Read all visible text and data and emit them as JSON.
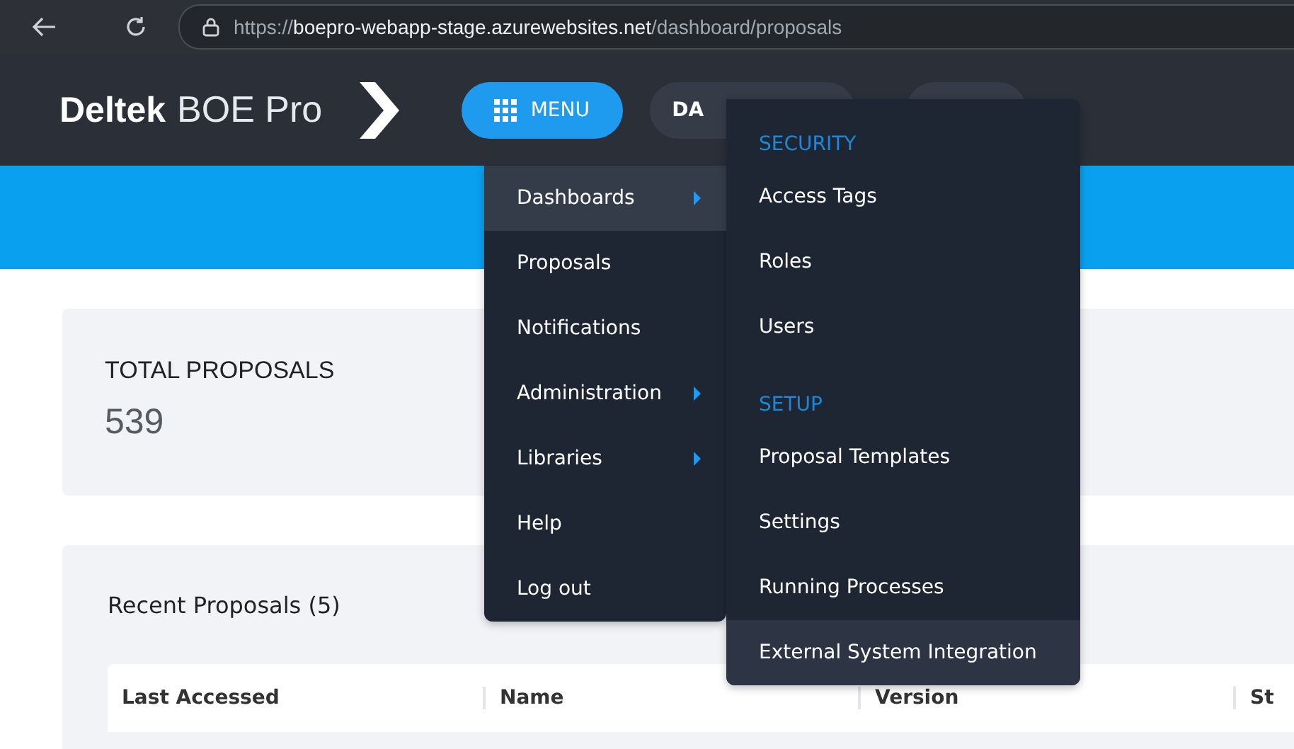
{
  "browser": {
    "url": "https://**boepro-webapp-stage.azurewebsites.net**/dashboard/proposals"
  },
  "header": {
    "brand_bold": "Deltek",
    "brand": "BOE Pro",
    "menu_button": "MENU",
    "nav_pills": [
      "DA"
    ]
  },
  "main_menu": [
    {
      "label": "Dashboards",
      "selected": true,
      "has_submenu": true
    },
    {
      "label": "Proposals",
      "selected": false,
      "has_submenu": false
    },
    {
      "label": "Notifications",
      "selected": false,
      "has_submenu": false
    },
    {
      "label": "Administration",
      "selected": false,
      "has_submenu": true
    },
    {
      "label": "Libraries",
      "selected": false,
      "has_submenu": true
    },
    {
      "label": "Help",
      "selected": false,
      "has_submenu": false
    },
    {
      "label": "Log out",
      "selected": false,
      "has_submenu": false
    }
  ],
  "submenu": [
    {
      "kind": "heading",
      "label": "SECURITY"
    },
    {
      "kind": "item",
      "label": "Access Tags",
      "selected": false
    },
    {
      "kind": "item",
      "label": "Roles",
      "selected": false
    },
    {
      "kind": "item",
      "label": "Users",
      "selected": false
    },
    {
      "kind": "heading",
      "label": "SETUP"
    },
    {
      "kind": "item",
      "label": "Proposal Templates",
      "selected": false
    },
    {
      "kind": "item",
      "label": "Settings",
      "selected": false
    },
    {
      "kind": "item",
      "label": "Running Processes",
      "selected": false
    },
    {
      "kind": "item",
      "label": "External System Integration",
      "selected": true
    }
  ],
  "total_card": {
    "title": "TOTAL PROPOSALS",
    "value": "539"
  },
  "recent": {
    "title": "Recent Proposals (5)",
    "columns": [
      "Last Accessed",
      "Name",
      "Version",
      "St"
    ]
  }
}
